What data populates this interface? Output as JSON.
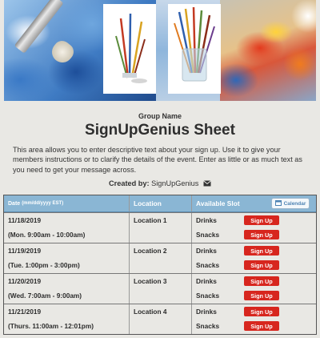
{
  "header": {
    "group_name": "Group Name",
    "title": "SignUpGenius Sheet",
    "description": "This area allows you to enter descriptive text about your sign up. Use it to give your members instructions or to clarify the details of the event. Enter as little or as much text as you need to get your message across.",
    "created_by_label": "Created by:",
    "created_by_name": "SignUpGenius"
  },
  "table": {
    "columns": {
      "date": "Date",
      "date_format": "(mm/dd/yyyy EST)",
      "location": "Location",
      "slot": "Available Slot",
      "calendar": "Calendar"
    },
    "rows": [
      {
        "date": "11/18/2019",
        "time": "(Mon. 9:00am - 10:00am)",
        "location": "Location 1",
        "slots": [
          {
            "name": "Drinks",
            "button": "Sign Up"
          },
          {
            "name": "Snacks",
            "button": "Sign Up"
          }
        ]
      },
      {
        "date": "11/19/2019",
        "time": "(Tue. 1:00pm - 3:00pm)",
        "location": "Location 2",
        "slots": [
          {
            "name": "Drinks",
            "button": "Sign Up"
          },
          {
            "name": "Snacks",
            "button": "Sign Up"
          }
        ]
      },
      {
        "date": "11/20/2019",
        "time": "(Wed. 7:00am - 9:00am)",
        "location": "Location 3",
        "slots": [
          {
            "name": "Drinks",
            "button": "Sign Up"
          },
          {
            "name": "Snacks",
            "button": "Sign Up"
          }
        ]
      },
      {
        "date": "11/21/2019",
        "time": "(Thurs. 11:00am - 12:01pm)",
        "location": "Location 4",
        "slots": [
          {
            "name": "Drinks",
            "button": "Sign Up"
          },
          {
            "name": "Snacks",
            "button": "Sign Up"
          }
        ]
      }
    ]
  },
  "colors": {
    "page_background": "#e9e8e4",
    "table_header": "#8ab6d4",
    "signup_button": "#d7261e",
    "calendar_text": "#4f84b4"
  },
  "icons": {
    "email": "envelope-icon",
    "calendar": "calendar-icon"
  }
}
